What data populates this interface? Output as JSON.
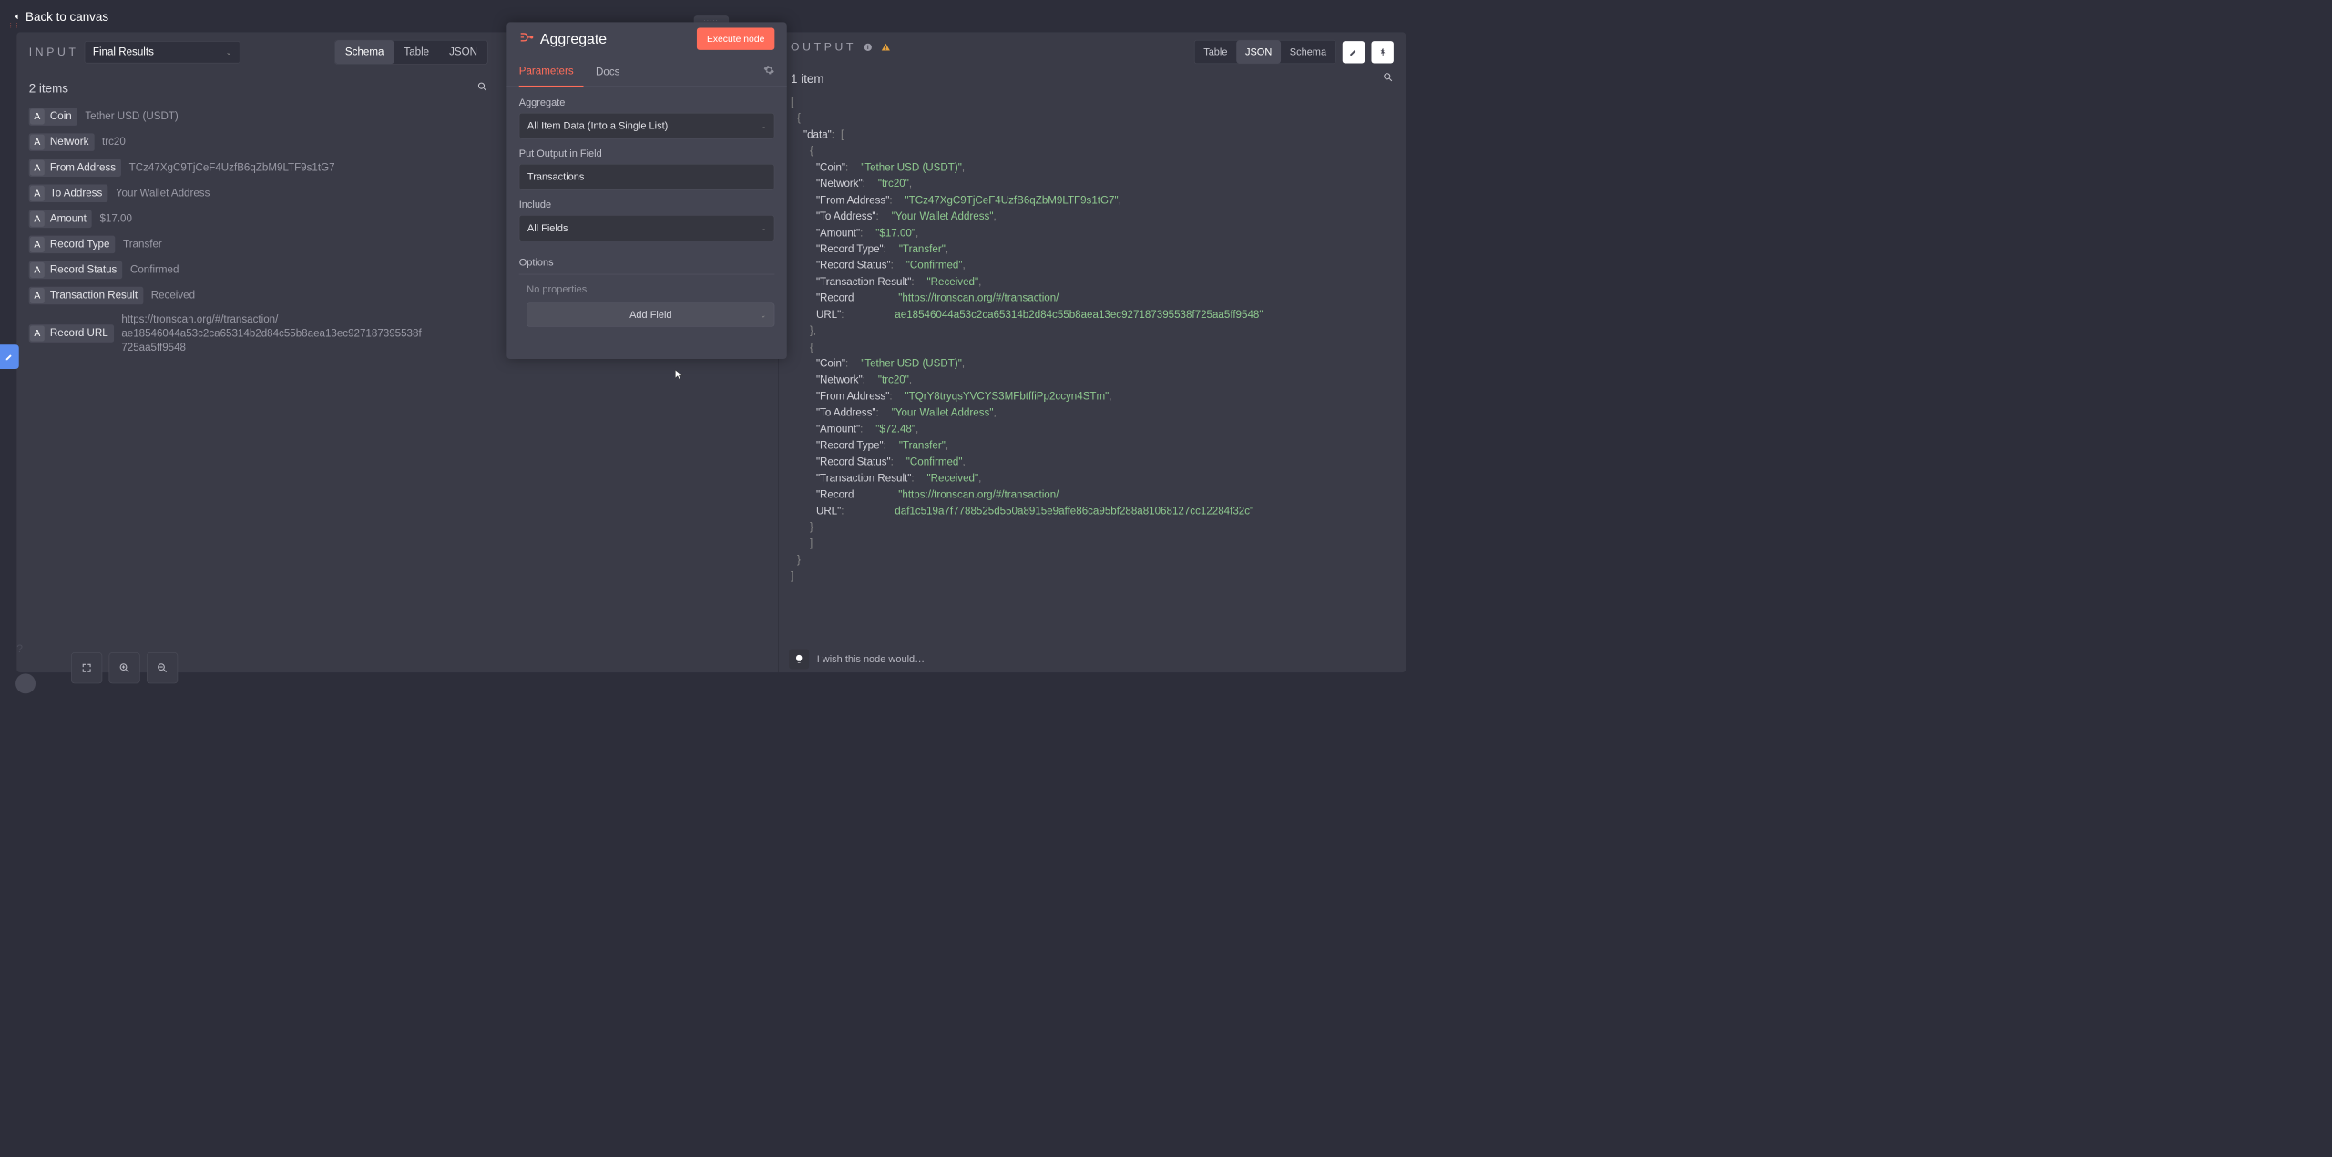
{
  "back_label": "Back to canvas",
  "input": {
    "label": "INPUT",
    "dropdown": "Final Results",
    "items_count": "2 items",
    "view_tabs": [
      "Schema",
      "Table",
      "JSON"
    ],
    "active_view": "Schema",
    "badge_letter": "A",
    "rows": [
      {
        "key": "Coin",
        "val": "Tether USD (USDT)"
      },
      {
        "key": "Network",
        "val": "trc20"
      },
      {
        "key": "From Address",
        "val": "TCz47XgC9TjCeF4UzfB6qZbM9LTF9s1tG7"
      },
      {
        "key": "To Address",
        "val": "Your Wallet Address"
      },
      {
        "key": "Amount",
        "val": "$17.00"
      },
      {
        "key": "Record Type",
        "val": "Transfer"
      },
      {
        "key": "Record Status",
        "val": "Confirmed"
      },
      {
        "key": "Transaction Result",
        "val": "Received"
      },
      {
        "key": "Record URL",
        "val": "https://tronscan.org/#/transaction/\nae18546044a53c2ca65314b2d84c55b8aea13ec927187395538f725aa5ff9548"
      }
    ]
  },
  "params": {
    "title": "Aggregate",
    "execute": "Execute node",
    "tabs": [
      "Parameters",
      "Docs"
    ],
    "active_tab": "Parameters",
    "aggregate_label": "Aggregate",
    "aggregate_value": "All Item Data (Into a Single List)",
    "put_output_label": "Put Output in Field",
    "put_output_value": "Transactions",
    "include_label": "Include",
    "include_value": "All Fields",
    "options_label": "Options",
    "no_props": "No properties",
    "add_field": "Add Field"
  },
  "output": {
    "label": "OUTPUT",
    "items_count": "1 item",
    "view_tabs": [
      "Table",
      "JSON",
      "Schema"
    ],
    "active_view": "JSON",
    "data": [
      {
        "Coin": "Tether USD (USDT)",
        "Network": "trc20",
        "From Address": "TCz47XgC9TjCeF4UzfB6qZbM9LTF9s1tG7",
        "To Address": "Your Wallet Address",
        "Amount": "$17.00",
        "Record Type": "Transfer",
        "Record Status": "Confirmed",
        "Transaction Result": "Received",
        "Record URL": "https://tronscan.org/#/transaction/ae18546044a53c2ca65314b2d84c55b8aea13ec927187395538f725aa5ff9548"
      },
      {
        "Coin": "Tether USD (USDT)",
        "Network": "trc20",
        "From Address": "TQrY8tryqsYVCYS3MFbtffiPp2ccyn4STm",
        "To Address": "Your Wallet Address",
        "Amount": "$72.48",
        "Record Type": "Transfer",
        "Record Status": "Confirmed",
        "Transaction Result": "Received",
        "Record URL": "https://tronscan.org/#/transaction/daf1c519a7f7788525d550a8915e9affe86ca95bf288a81068127cc12284f32c"
      }
    ]
  },
  "wish": "I wish this node would…"
}
